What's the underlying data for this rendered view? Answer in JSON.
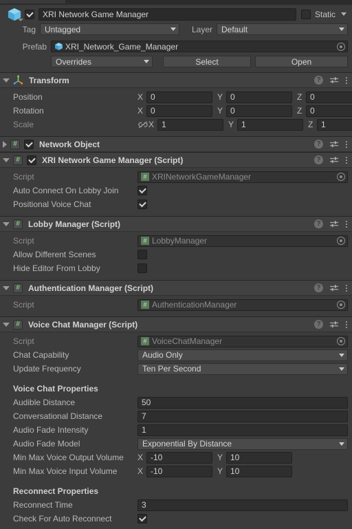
{
  "gameobject": {
    "icon": "cube-icon",
    "enabled": true,
    "name": "XRI Network Game Manager",
    "static_label": "Static",
    "static_checked": false,
    "tag_label": "Tag",
    "tag_value": "Untagged",
    "layer_label": "Layer",
    "layer_value": "Default",
    "prefab_label": "Prefab",
    "prefab_value": "XRI_Network_Game_Manager",
    "overrides_label": "Overrides",
    "select_label": "Select",
    "open_label": "Open"
  },
  "header_icons": {
    "help": "?",
    "preset": "preset-icon",
    "menu": "kebab-menu-icon"
  },
  "components": [
    {
      "title": "Transform",
      "icon": "transform-gizmo-icon",
      "expanded": true,
      "has_enable_toggle": false,
      "rows": [
        {
          "kind": "vector3",
          "label": "Position",
          "dim": false,
          "link": false,
          "axes": [
            "X",
            "Y",
            "Z"
          ],
          "values": [
            "0",
            "0",
            "0"
          ]
        },
        {
          "kind": "vector3",
          "label": "Rotation",
          "dim": false,
          "link": false,
          "axes": [
            "X",
            "Y",
            "Z"
          ],
          "values": [
            "0",
            "0",
            "0"
          ]
        },
        {
          "kind": "vector3",
          "label": "Scale",
          "dim": true,
          "link": true,
          "axes": [
            "X",
            "Y",
            "Z"
          ],
          "values": [
            "1",
            "1",
            "1"
          ]
        }
      ]
    },
    {
      "title": "Network Object",
      "icon": "script-icon",
      "expanded": false,
      "has_enable_toggle": true,
      "enabled": true,
      "rows": []
    },
    {
      "title": "XRI Network Game Manager (Script)",
      "icon": "script-icon",
      "expanded": true,
      "has_enable_toggle": true,
      "enabled": true,
      "rows": [
        {
          "kind": "object",
          "label": "Script",
          "dim": true,
          "value": "XRINetworkGameManager"
        },
        {
          "kind": "checkbox",
          "label": "Auto Connect On Lobby Join",
          "dim": false,
          "checked": true
        },
        {
          "kind": "checkbox",
          "label": "Positional Voice Chat",
          "dim": false,
          "checked": true
        }
      ]
    },
    {
      "title": "Lobby Manager (Script)",
      "icon": "script-icon",
      "expanded": true,
      "has_enable_toggle": false,
      "rows": [
        {
          "kind": "object",
          "label": "Script",
          "dim": true,
          "value": "LobbyManager"
        },
        {
          "kind": "checkbox",
          "label": "Allow Different Scenes",
          "dim": false,
          "checked": false
        },
        {
          "kind": "checkbox",
          "label": "Hide Editor From Lobby",
          "dim": false,
          "checked": false
        }
      ]
    },
    {
      "title": "Authentication Manager (Script)",
      "icon": "script-icon",
      "expanded": true,
      "has_enable_toggle": false,
      "rows": [
        {
          "kind": "object",
          "label": "Script",
          "dim": true,
          "value": "AuthenticationManager"
        }
      ]
    },
    {
      "title": "Voice Chat Manager (Script)",
      "icon": "script-icon",
      "expanded": true,
      "has_enable_toggle": false,
      "rows": [
        {
          "kind": "object",
          "label": "Script",
          "dim": true,
          "value": "VoiceChatManager"
        },
        {
          "kind": "dropdown",
          "label": "Chat Capability",
          "dim": false,
          "value": "Audio Only"
        },
        {
          "kind": "dropdown",
          "label": "Update Frequency",
          "dim": false,
          "value": "Ten Per Second"
        },
        {
          "kind": "spacer"
        },
        {
          "kind": "heading",
          "label": "Voice Chat Properties"
        },
        {
          "kind": "number",
          "label": "Audible Distance",
          "dim": false,
          "value": "50"
        },
        {
          "kind": "number",
          "label": "Conversational Distance",
          "dim": false,
          "value": "7"
        },
        {
          "kind": "number",
          "label": "Audio Fade Intensity",
          "dim": false,
          "value": "1"
        },
        {
          "kind": "dropdown",
          "label": "Audio Fade Model",
          "dim": false,
          "value": "Exponential By Distance"
        },
        {
          "kind": "vector2",
          "label": "Min Max Voice Output Volume",
          "dim": false,
          "axes": [
            "X",
            "Y"
          ],
          "values": [
            "-10",
            "10"
          ]
        },
        {
          "kind": "vector2",
          "label": "Min Max Voice Input Volume",
          "dim": false,
          "axes": [
            "X",
            "Y"
          ],
          "values": [
            "-10",
            "10"
          ]
        },
        {
          "kind": "spacer"
        },
        {
          "kind": "heading",
          "label": "Reconnect Properties"
        },
        {
          "kind": "number",
          "label": "Reconnect Time",
          "dim": false,
          "value": "3"
        },
        {
          "kind": "checkbox",
          "label": "Check For Auto Reconnect",
          "dim": false,
          "checked": true
        }
      ]
    }
  ],
  "colors": {
    "background": "#383838",
    "panel": "#3c3c3c",
    "header": "#414141",
    "field": "#2e2e2e",
    "dropdown": "#4a4a4a",
    "text": "#c4c4c4",
    "text_dim": "#8e8e8e",
    "prefab_blue": "#6bbfe8",
    "script_green": "#5d7a5d"
  }
}
